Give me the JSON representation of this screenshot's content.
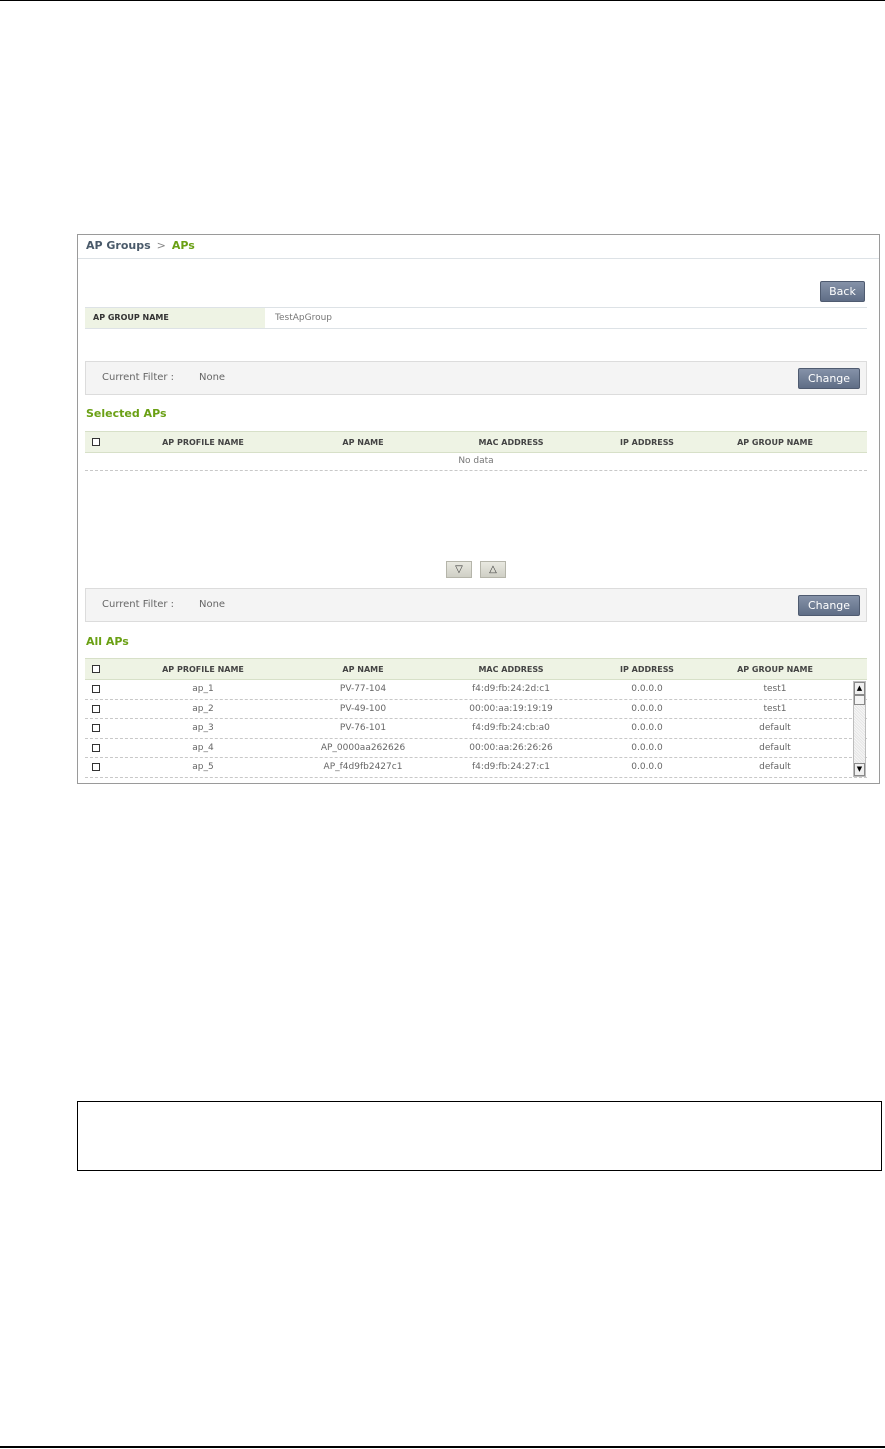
{
  "breadcrumb": {
    "parent": "AP Groups",
    "separator": ">",
    "current": "APs"
  },
  "back_label": "Back",
  "group_info": {
    "label": "AP GROUP NAME",
    "value": "TestApGroup"
  },
  "filter_top": {
    "label": "Current Filter :",
    "value": "None",
    "change_label": "Change"
  },
  "filter_bottom": {
    "label": "Current Filter :",
    "value": "None",
    "change_label": "Change"
  },
  "selected_title": "Selected APs",
  "all_title": "All APs",
  "columns": {
    "profile": "AP PROFILE NAME",
    "name": "AP NAME",
    "mac": "MAC ADDRESS",
    "ip": "IP ADDRESS",
    "group": "AP GROUP NAME"
  },
  "no_data": "No data",
  "move_down_glyph": "▽",
  "move_up_glyph": "△",
  "all_aps": [
    {
      "profile": "ap_1",
      "name": "PV-77-104",
      "mac": "f4:d9:fb:24:2d:c1",
      "ip": "0.0.0.0",
      "group": "test1"
    },
    {
      "profile": "ap_2",
      "name": "PV-49-100",
      "mac": "00:00:aa:19:19:19",
      "ip": "0.0.0.0",
      "group": "test1"
    },
    {
      "profile": "ap_3",
      "name": "PV-76-101",
      "mac": "f4:d9:fb:24:cb:a0",
      "ip": "0.0.0.0",
      "group": "default"
    },
    {
      "profile": "ap_4",
      "name": "AP_0000aa262626",
      "mac": "00:00:aa:26:26:26",
      "ip": "0.0.0.0",
      "group": "default"
    },
    {
      "profile": "ap_5",
      "name": "AP_f4d9fb2427c1",
      "mac": "f4:d9:fb:24:27:c1",
      "ip": "0.0.0.0",
      "group": "default"
    }
  ]
}
